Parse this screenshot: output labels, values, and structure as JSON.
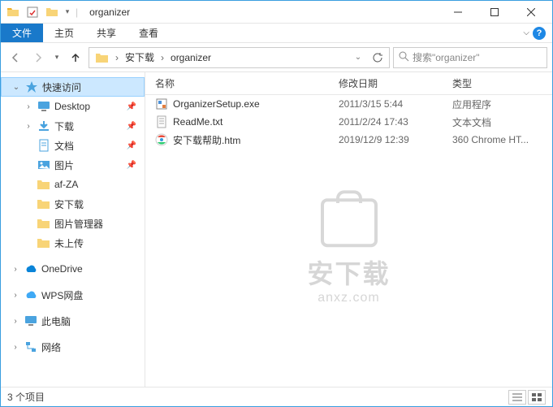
{
  "window": {
    "title": "organizer"
  },
  "ribbon": {
    "file": "文件",
    "home": "主页",
    "share": "共享",
    "view": "查看"
  },
  "breadcrumb": {
    "items": [
      "安下载",
      "organizer"
    ]
  },
  "search": {
    "placeholder": "搜索\"organizer\""
  },
  "sidebar": {
    "quick": "快速访问",
    "desktop": "Desktop",
    "downloads": "下载",
    "documents": "文档",
    "pictures": "图片",
    "afza": "af-ZA",
    "anxiazai": "安下载",
    "picmgr": "图片管理器",
    "notuploaded": "未上传",
    "onedrive": "OneDrive",
    "wps": "WPS网盘",
    "thispc": "此电脑",
    "network": "网络"
  },
  "columns": {
    "name": "名称",
    "date": "修改日期",
    "type": "类型"
  },
  "files": [
    {
      "name": "OrganizerSetup.exe",
      "date": "2011/3/15 5:44",
      "type": "应用程序"
    },
    {
      "name": "ReadMe.txt",
      "date": "2011/2/24 17:43",
      "type": "文本文档"
    },
    {
      "name": "安下载帮助.htm",
      "date": "2019/12/9 12:39",
      "type": "360 Chrome HT..."
    }
  ],
  "watermark": {
    "text": "安下载",
    "sub": "anxz.com"
  },
  "status": {
    "count": "3 个项目"
  }
}
